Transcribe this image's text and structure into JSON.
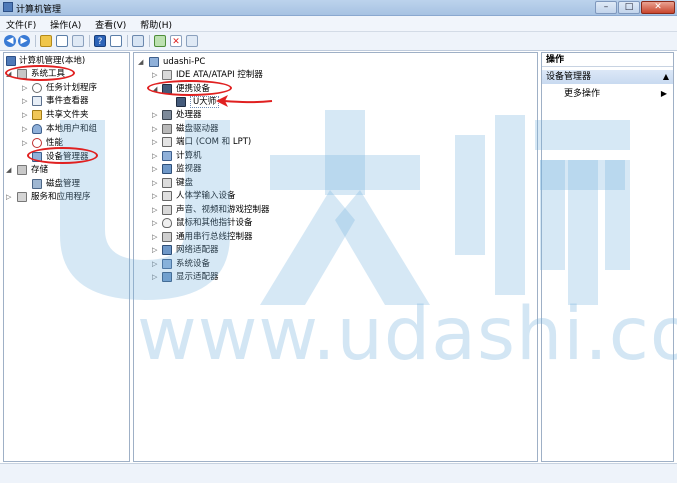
{
  "window": {
    "title": "计算机管理"
  },
  "menu": [
    "文件(F)",
    "操作(A)",
    "查看(V)",
    "帮助(H)"
  ],
  "toolbar": [
    "back-icon",
    "forward-icon",
    "up-folder-icon",
    "show-tree-icon",
    "refresh-icon",
    "properties-icon",
    "help-icon",
    "show-pane-icon",
    "scan-hardware-icon",
    "update-driver-icon",
    "disable-device-icon",
    "uninstall-device-icon"
  ],
  "left_tree": {
    "root": "计算机管理(本地)",
    "system_tools": "系统工具",
    "task_scheduler": "任务计划程序",
    "event_viewer": "事件查看器",
    "shared_folders": "共享文件夹",
    "local_users": "本地用户和组",
    "performance": "性能",
    "device_manager": "设备管理器",
    "storage": "存储",
    "disk_management": "磁盘管理",
    "services_apps": "服务和应用程序"
  },
  "device_tree": {
    "root": "udashi-PC",
    "items": [
      {
        "label": "IDE ATA/ATAPI 控制器"
      },
      {
        "label": "便携设备"
      },
      {
        "label": "U大师"
      },
      {
        "label": "处理器"
      },
      {
        "label": "磁盘驱动器"
      },
      {
        "label": "端口 (COM 和 LPT)"
      },
      {
        "label": "计算机"
      },
      {
        "label": "监视器"
      },
      {
        "label": "键盘"
      },
      {
        "label": "人体学输入设备"
      },
      {
        "label": "声音、视频和游戏控制器"
      },
      {
        "label": "鼠标和其他指针设备"
      },
      {
        "label": "通用串行总线控制器"
      },
      {
        "label": "网络适配器"
      },
      {
        "label": "系统设备"
      },
      {
        "label": "显示适配器"
      }
    ]
  },
  "actions": {
    "header": "操作",
    "section": "设备管理器",
    "more": "更多操作"
  },
  "watermark": {
    "text": "www.udashi.com",
    "logo": "U大师"
  },
  "colors": {
    "annotation": "#e02020",
    "watermark": "#7ab2de",
    "selection": "#c8daf0"
  }
}
